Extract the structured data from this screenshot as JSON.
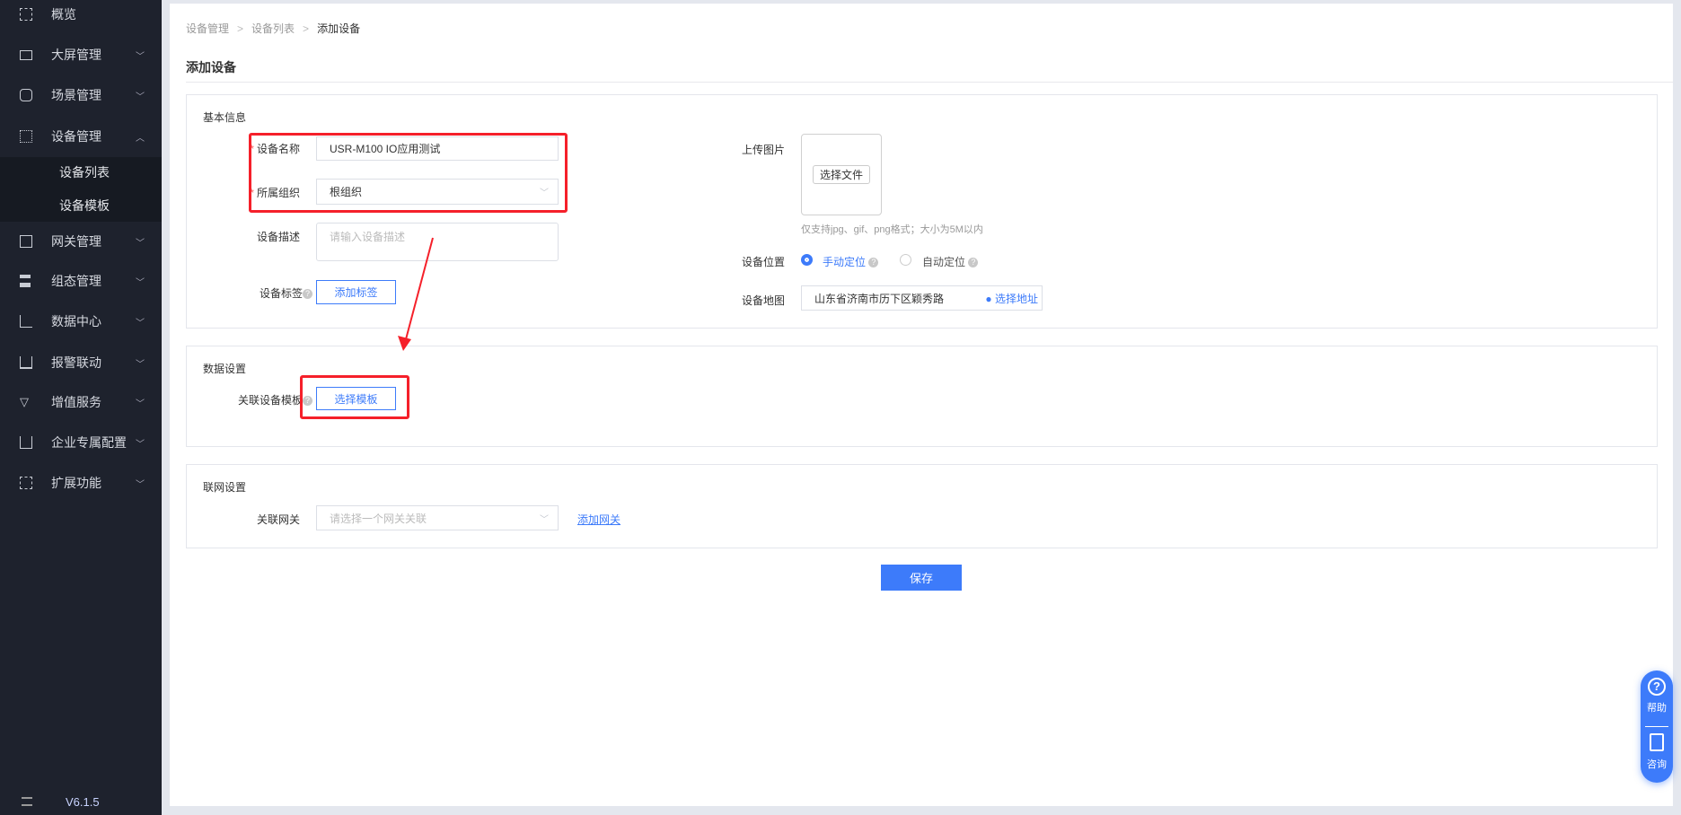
{
  "sidebar": {
    "items": [
      {
        "label": "概览",
        "icon": "overview-icon"
      },
      {
        "label": "大屏管理",
        "icon": "screen-icon"
      },
      {
        "label": "场景管理",
        "icon": "scene-icon"
      },
      {
        "label": "设备管理",
        "icon": "device-icon"
      },
      {
        "label": "网关管理",
        "icon": "gateway-icon"
      },
      {
        "label": "组态管理",
        "icon": "topology-icon"
      },
      {
        "label": "数据中心",
        "icon": "chart-icon"
      },
      {
        "label": "报警联动",
        "icon": "alarm-icon"
      },
      {
        "label": "增值服务",
        "icon": "diamond-icon"
      },
      {
        "label": "企业专属配置",
        "icon": "building-icon"
      },
      {
        "label": "扩展功能",
        "icon": "grid-icon"
      }
    ],
    "subitems": [
      "设备列表",
      "设备模板"
    ],
    "version": "V6.1.5"
  },
  "breadcrumb": [
    "设备管理",
    "设备列表",
    "添加设备"
  ],
  "page_title": "添加设备",
  "basic": {
    "title": "基本信息",
    "name_label": "设备名称",
    "name_value": "USR-M100 IO应用测试",
    "org_label": "所属组织",
    "org_value": "根组织",
    "desc_label": "设备描述",
    "desc_placeholder": "请输入设备描述",
    "tag_label": "设备标签",
    "tag_button": "添加标签",
    "upload_label": "上传图片",
    "upload_button": "选择文件",
    "upload_hint": "仅支持jpg、gif、png格式；大小为5M以内",
    "location_label": "设备位置",
    "location_manual": "手动定位",
    "location_auto": "自动定位",
    "map_label": "设备地图",
    "map_value": "山东省济南市历下区颖秀路",
    "map_button": "选择地址"
  },
  "data_settings": {
    "title": "数据设置",
    "template_label": "关联设备模板",
    "template_button": "选择模板"
  },
  "network": {
    "title": "联网设置",
    "gateway_label": "关联网关",
    "gateway_placeholder": "请选择一个网关关联",
    "add_gateway": "添加网关"
  },
  "save_label": "保存",
  "float": {
    "help": "帮助",
    "consult": "咨询"
  },
  "colors": {
    "primary": "#3d7bfa",
    "sidebar": "#1e222d",
    "annotation": "#f5202a"
  }
}
